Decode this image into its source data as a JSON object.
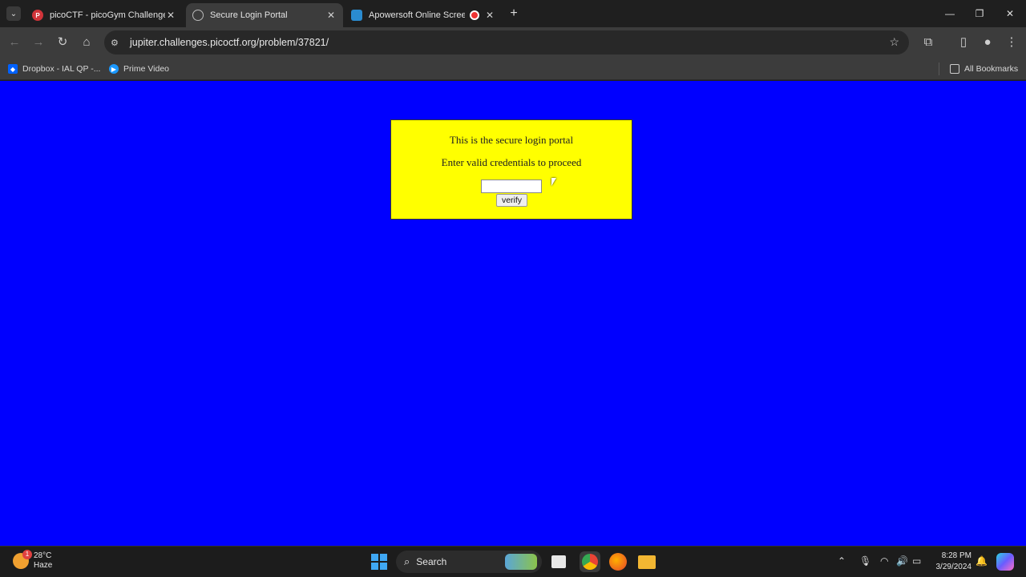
{
  "browser": {
    "tabs": [
      {
        "title": "picoCTF - picoGym Challenges",
        "favicon": "picoctf-icon"
      },
      {
        "title": "Secure Login Portal",
        "favicon": "globe-icon",
        "active": true
      },
      {
        "title": "Apowersoft Online Screen R",
        "favicon": "apowersoft-icon",
        "recording": true
      }
    ],
    "address": {
      "url": "jupiter.challenges.picoctf.org/problem/37821/"
    },
    "bookmarks": [
      {
        "label": "Dropbox - IAL QP -...",
        "icon": "dropbox-icon"
      },
      {
        "label": "Prime Video",
        "icon": "prime-video-icon"
      }
    ],
    "all_bookmarks": "All Bookmarks"
  },
  "page": {
    "background": "#0000ff",
    "panel_color": "#ffff00",
    "heading": "This is the secure login portal",
    "instruction": "Enter valid credentials to proceed",
    "input_value": "",
    "verify_label": "verify"
  },
  "taskbar": {
    "weather": {
      "temp": "28°C",
      "condition": "Haze",
      "badge": "1"
    },
    "search_label": "Search",
    "time": "8:28 PM",
    "date": "3/29/2024"
  }
}
